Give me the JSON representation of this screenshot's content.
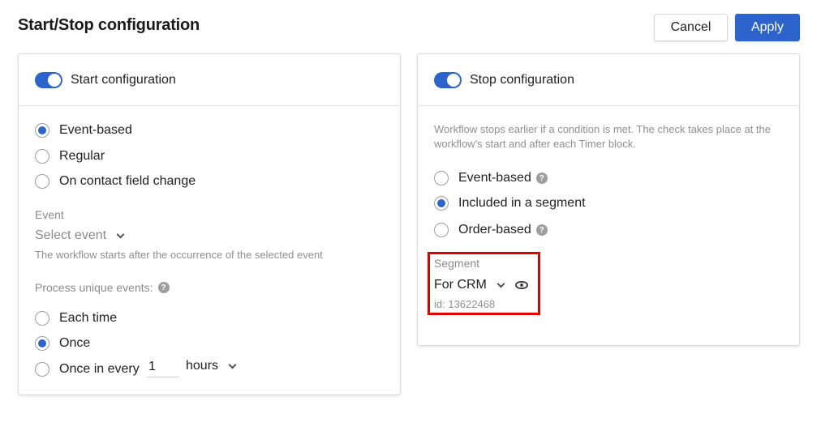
{
  "header": {
    "title": "Start/Stop configuration",
    "cancel_label": "Cancel",
    "apply_label": "Apply"
  },
  "start": {
    "toggle_label": "Start configuration",
    "toggle_on": true,
    "type_options": [
      {
        "label": "Event-based",
        "checked": true
      },
      {
        "label": "Regular",
        "checked": false
      },
      {
        "label": "On contact field change",
        "checked": false
      }
    ],
    "event_label": "Event",
    "event_placeholder": "Select event",
    "event_hint": "The workflow starts after the occurrence of the selected event",
    "unique_label": "Process unique events:",
    "unique_options": [
      {
        "label": "Each time",
        "checked": false
      },
      {
        "label": "Once",
        "checked": true
      },
      {
        "label": "Once in every",
        "checked": false
      }
    ],
    "interval_value": "1",
    "interval_unit": "hours"
  },
  "stop": {
    "toggle_label": "Stop configuration",
    "toggle_on": true,
    "description": "Workflow stops earlier if a condition is met. The check takes place at the workflow's start and after each Timer block.",
    "options": [
      {
        "label": "Event-based",
        "checked": false,
        "help": true
      },
      {
        "label": "Included in a segment",
        "checked": true,
        "help": false
      },
      {
        "label": "Order-based",
        "checked": false,
        "help": true
      }
    ],
    "segment_label": "Segment",
    "segment_value": "For CRM",
    "segment_id": "id: 13622468"
  },
  "colors": {
    "accent": "#2c64cc",
    "highlight": "#e00000"
  }
}
